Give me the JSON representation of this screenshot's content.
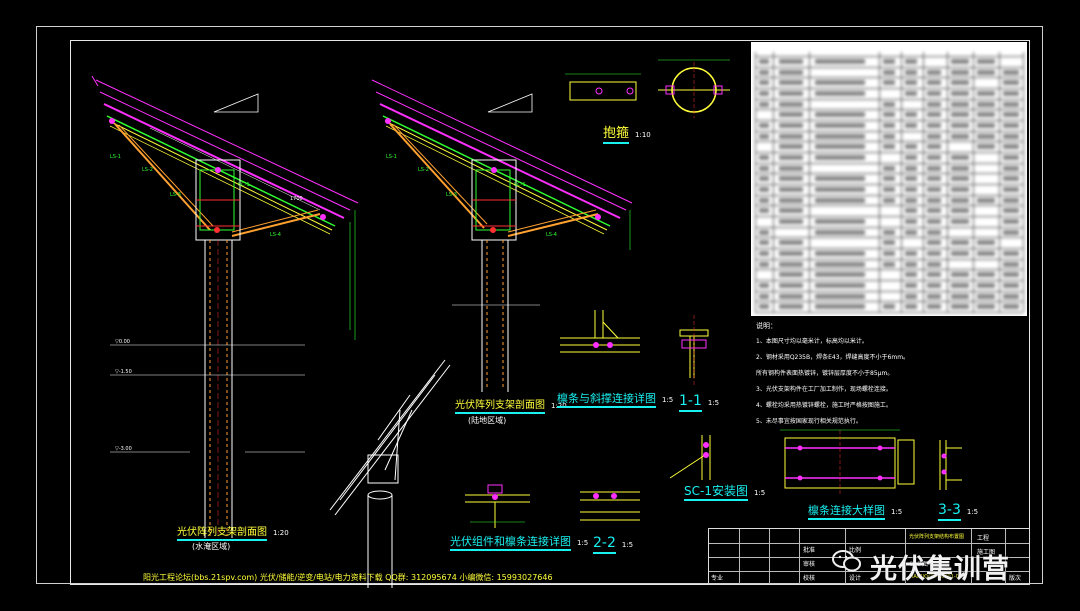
{
  "titles": {
    "section_flood": "光伏阵列支架剖面图",
    "section_flood_area": "(水淹区域)",
    "section_flood_scale": "1:20",
    "section_land": "光伏阵列支架剖面图",
    "section_land_area": "(陆地区域)",
    "section_land_scale": "1:20",
    "hoop": "抱箍",
    "hoop_scale": "1:10",
    "purlin_brace": "檩条与斜撑连接详图",
    "purlin_brace_scale": "1:5",
    "sec11": "1-1",
    "sec11_scale": "1:5",
    "sc1": "SC-1安装图",
    "sc1_scale": "1:5",
    "pv_purlin": "光伏组件和檩条连接详图",
    "pv_purlin_scale": "1:5",
    "sec22": "2-2",
    "sec22_scale": "1:5",
    "purlin_joint": "檩条连接大样图",
    "purlin_joint_scale": "1:5",
    "sec33": "3-3",
    "sec33_scale": "1:5"
  },
  "notes": {
    "heading": "说明：",
    "items": [
      "1、本图尺寸均以毫米计，标高均以米计。",
      "2、钢材采用Q235B，焊条E43，焊缝高度不小于6mm。",
      "   所有钢构件表面热镀锌，镀锌层厚度不小于85μm。",
      "3、光伏支架构件在工厂加工制作，现场螺栓连接。",
      "4、螺栓均采用热镀锌螺栓，施工时严格按图施工。",
      "5、未尽事宜按国家现行相关规范执行。"
    ]
  },
  "footer": "阳光工程论坛(bbs.21spv.com)   光伏/储能/逆变/电站/电力资料下载   QQ群: 312095674   小编微信: 15993027646",
  "title_block": {
    "project_label": "工程",
    "stage_label": "施工图",
    "drawing_title": "光伏阵列支架结构布置图",
    "drawing_no": "MA01KV75-10801-07",
    "roles": [
      "批准",
      "审核",
      "校核",
      "设计"
    ],
    "specialty": "专业",
    "scale_label": "比例",
    "date_label": "日期",
    "edition_label": "版次",
    "cad_label": "CAD图号"
  },
  "watermark": "光伏集训营",
  "colors": {
    "yellow": "#ffff3a",
    "cyan": "#19f0f0",
    "magenta": "#ff30ff",
    "orange": "#ffa030",
    "red": "#ff3030",
    "green": "#30ff30",
    "white": "#ffffff"
  }
}
